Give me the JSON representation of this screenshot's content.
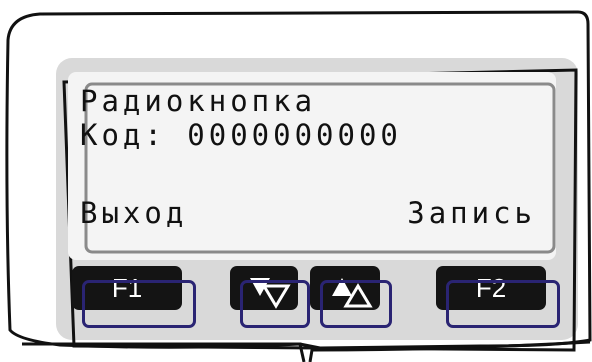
{
  "device": {
    "colors": {
      "bezel": "#d9d9d9",
      "keys": "#141414",
      "highlight": "#2a2473"
    }
  },
  "lcd": {
    "line1": "Радиокнопка",
    "line2": "Код: 0000000000",
    "softkey_left": "Выход",
    "softkey_right": "Запись"
  },
  "keys": {
    "f1": "F1",
    "down_icon": "down-arrow-icon",
    "up_icon": "up-arrow-icon",
    "f2": "F2"
  }
}
